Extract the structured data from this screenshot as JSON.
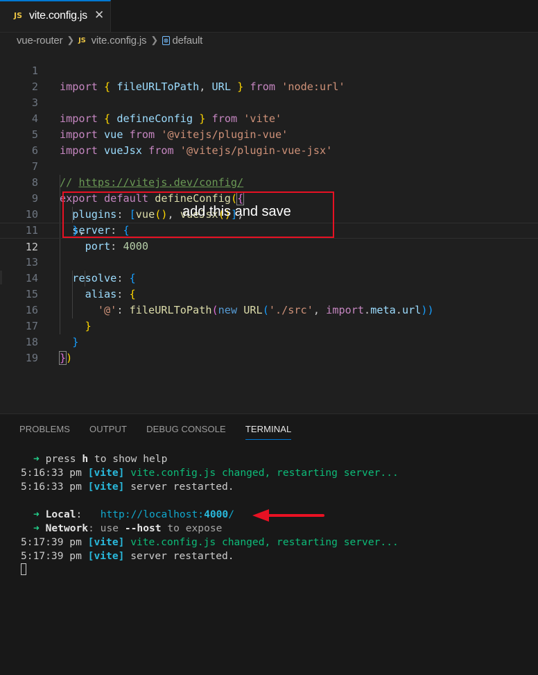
{
  "tab": {
    "icon_label": "JS",
    "filename": "vite.config.js",
    "close": "✕"
  },
  "breadcrumb": {
    "folder": "vue-router",
    "file_icon": "JS",
    "file": "vite.config.js",
    "symbol_icon": "⊗",
    "symbol": "default"
  },
  "editor": {
    "line_numbers": [
      "1",
      "2",
      "3",
      "4",
      "5",
      "6",
      "7",
      "8",
      "9",
      "10",
      "11",
      "12",
      "13",
      "14",
      "15",
      "16",
      "17",
      "18",
      "19"
    ],
    "active_line": 12,
    "lines": [
      {
        "t1": "import",
        "t2": "{",
        "t3": "fileURLToPath",
        "t4": ",",
        "t5": "URL",
        "t6": "}",
        "t7": "from",
        "t8": "'node:url'"
      },
      {},
      {
        "t1": "import",
        "t2": "{",
        "t3": "defineConfig",
        "t4": "}",
        "t5": "from",
        "t6": "'vite'"
      },
      {
        "t1": "import",
        "t2": "vue",
        "t3": "from",
        "t4": "'@vitejs/plugin-vue'"
      },
      {
        "t1": "import",
        "t2": "vueJsx",
        "t3": "from",
        "t4": "'@vitejs/plugin-vue-jsx'"
      },
      {},
      {
        "t1": "// ",
        "t2": "https://vitejs.dev/config/"
      },
      {
        "t1": "export",
        "t2": "default",
        "t3": "defineConfig",
        "t4": "(",
        "t5": "{"
      },
      {
        "t1": "plugins",
        "t2": ":",
        "t3": "[",
        "t4": "vue",
        "t5": "()",
        "t6": ",",
        "t7": "vueJsx",
        "t8": "()",
        "t9": "]",
        "t10": ","
      },
      {
        "t1": "server",
        "t2": ":",
        "t3": "{"
      },
      {
        "t1": "port",
        "t2": ":",
        "t3": "4000"
      },
      {
        "t1": "}",
        "t2": ","
      },
      {
        "t1": "resolve",
        "t2": ":",
        "t3": "{"
      },
      {
        "t1": "alias",
        "t2": ":",
        "t3": "{"
      },
      {
        "t1": "'@'",
        "t2": ":",
        "t3": "fileURLToPath",
        "t4": "(",
        "t5": "new",
        "t6": "URL",
        "t7": "(",
        "t8": "'./src'",
        "t9": ",",
        "t10": "import",
        "t11": ".",
        "t12": "meta",
        "t13": ".",
        "t14": "url",
        "t15": "))"
      },
      {
        "t1": "}"
      },
      {
        "t1": "}"
      },
      {
        "t1": "}",
        "t2": ")"
      },
      {}
    ]
  },
  "annotation": {
    "text": "add this and save",
    "color": "#e81123"
  },
  "panel": {
    "tabs": [
      "PROBLEMS",
      "OUTPUT",
      "DEBUG CONSOLE",
      "TERMINAL"
    ],
    "active_tab": "TERMINAL"
  },
  "terminal": {
    "l1": {
      "arrow": "➜",
      "a": "press",
      "b": "h",
      "c": "to show help"
    },
    "l2": {
      "time": "5:16:33 pm",
      "tag": "[vite]",
      "msg": "vite.config.js changed, restarting server..."
    },
    "l3": {
      "time": "5:16:33 pm",
      "tag": "[vite]",
      "msg": "server restarted."
    },
    "l4": {
      "arrow": "➜",
      "label": "Local",
      "colon": ":",
      "url_pre": "http://localhost:",
      "port": "4000",
      "url_post": "/"
    },
    "l5": {
      "arrow": "➜",
      "label": "Network",
      "a": ": use",
      "flag": "--host",
      "b": "to expose"
    },
    "l6": {
      "time": "5:17:39 pm",
      "tag": "[vite]",
      "msg": "vite.config.js changed, restarting server..."
    },
    "l7": {
      "time": "5:17:39 pm",
      "tag": "[vite]",
      "msg": "server restarted."
    }
  }
}
